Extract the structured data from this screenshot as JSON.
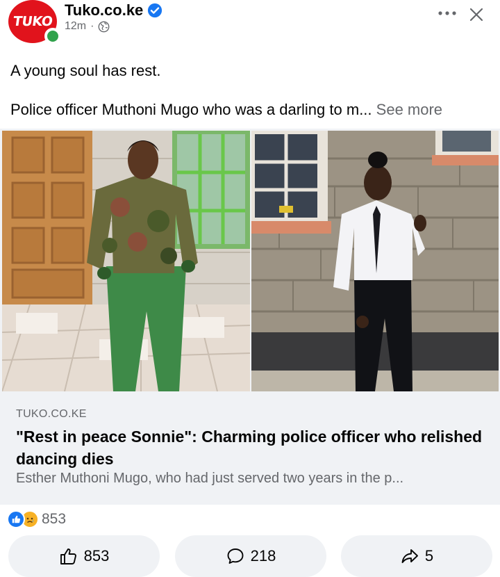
{
  "post": {
    "page_name": "Tuko.co.ke",
    "avatar_text": "TUKO",
    "time": "12m",
    "separator": "·",
    "text_line1": "A young soul has rest.",
    "text_line2": "Police officer Muthoni Mugo who was a darling to m",
    "ellipsis": "...",
    "see_more": "See more"
  },
  "link": {
    "domain": "TUKO.CO.KE",
    "title": "\"Rest in peace Sonnie\": Charming police officer who relished dancing dies",
    "description": "Esther Muthoni Mugo, who had just served two years in the p..."
  },
  "reactions": {
    "count": "853",
    "types": [
      "like",
      "sad"
    ]
  },
  "actions": {
    "like_count": "853",
    "comment_count": "218",
    "share_count": "5"
  },
  "colors": {
    "brand_red": "#e1131c",
    "facebook_blue": "#1877f2",
    "online_green": "#31a24c",
    "secondary_text": "#65676b",
    "surface": "#f0f2f5"
  },
  "icons": {
    "verified": "verified-badge-icon",
    "privacy": "globe-icon",
    "more": "more-options-icon",
    "close": "close-icon",
    "like": "thumbs-up-icon",
    "comment": "comment-bubble-icon",
    "share": "share-arrow-icon"
  }
}
